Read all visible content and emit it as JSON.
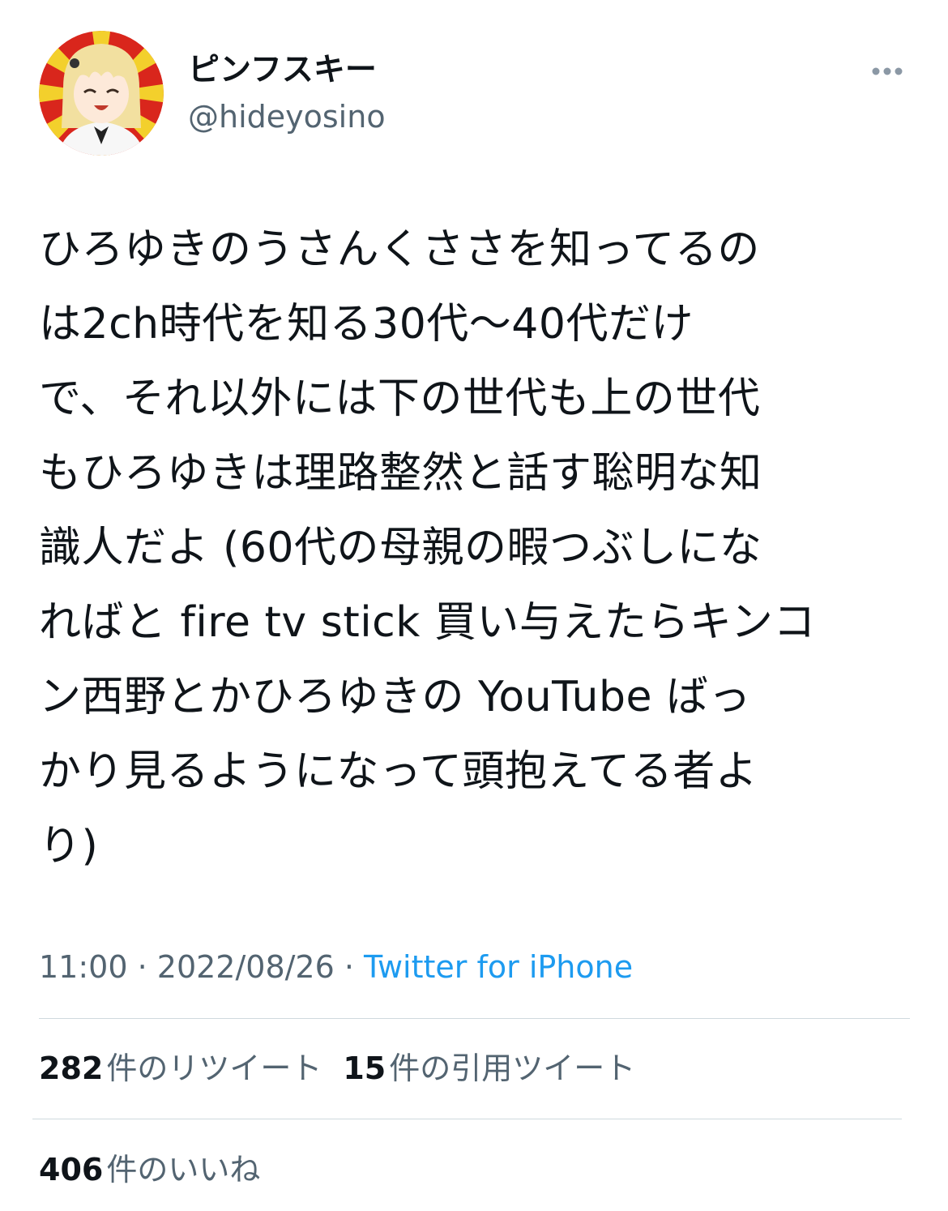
{
  "user": {
    "display_name": "ピンフスキー",
    "handle": "@hideyosino",
    "avatar_icon": "anime-avatar-rising-sun"
  },
  "more_icon": "more-horizontal-icon",
  "tweet": {
    "text": "ひろゆきのうさんくささを知ってるの\nは2ch時代を知る30代〜40代だけ\nで、それ以外には下の世代も上の世代\nもひろゆきは理路整然と話す聡明な知\n識人だよ (60代の母親の暇つぶしにな\nればと fire tv stick 買い与えたらキンコ\nン西野とかひろゆきの YouTube ばっ\nかり見るようになって頭抱えてる者よ\nり)"
  },
  "meta": {
    "time": "11:00",
    "separator": " · ",
    "date": "2022/08/26",
    "source": "Twitter for iPhone"
  },
  "stats": {
    "retweets": {
      "count": "282",
      "label": "件のリツイート"
    },
    "quotes": {
      "count": "15",
      "label": "件の引用ツイート"
    },
    "likes": {
      "count": "406",
      "label": "件のいいね"
    }
  },
  "colors": {
    "text": "#0f1419",
    "secondary": "#536471",
    "link": "#1d9bf0",
    "divider": "#cfd9de",
    "avatar_red": "#d9261c",
    "avatar_yellow": "#f3d02c"
  }
}
